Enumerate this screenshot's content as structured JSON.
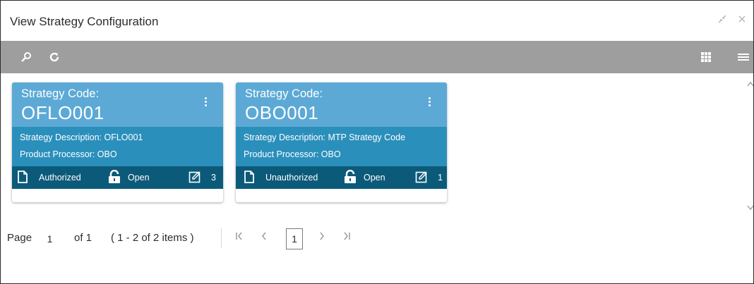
{
  "window": {
    "title": "View Strategy Configuration",
    "minimize_icon": "collapse-arrows-icon",
    "close_icon": "close-icon"
  },
  "toolbar": {
    "search_icon": "search-icon",
    "refresh_icon": "refresh-icon",
    "grid_view_icon": "grid-view-icon",
    "list_view_icon": "list-view-icon"
  },
  "cards": [
    {
      "label": "Strategy Code:",
      "code": "OFLO001",
      "description": "Strategy Description: OFLO001",
      "processor": "Product Processor: OBO",
      "auth_status": "Authorized",
      "record_status": "Open",
      "modifications": "3"
    },
    {
      "label": "Strategy Code:",
      "code": "OBO001",
      "description": "Strategy Description: MTP Strategy Code",
      "processor": "Product Processor: OBO",
      "auth_status": "Unauthorized",
      "record_status": "Open",
      "modifications": "1"
    }
  ],
  "colors": {
    "card_head": "#5ca9d6",
    "card_body": "#2b8fbc",
    "card_footer": "#0c5a7a",
    "toolbar": "#9e9e9e"
  },
  "pagination": {
    "page_label": "Page",
    "page_value": "1",
    "of_label": "of 1",
    "items_label": "( 1 - 2 of 2 items )",
    "current_page": "1",
    "first_icon": "first-page-icon",
    "prev_icon": "prev-page-icon",
    "next_icon": "next-page-icon",
    "last_icon": "last-page-icon"
  }
}
